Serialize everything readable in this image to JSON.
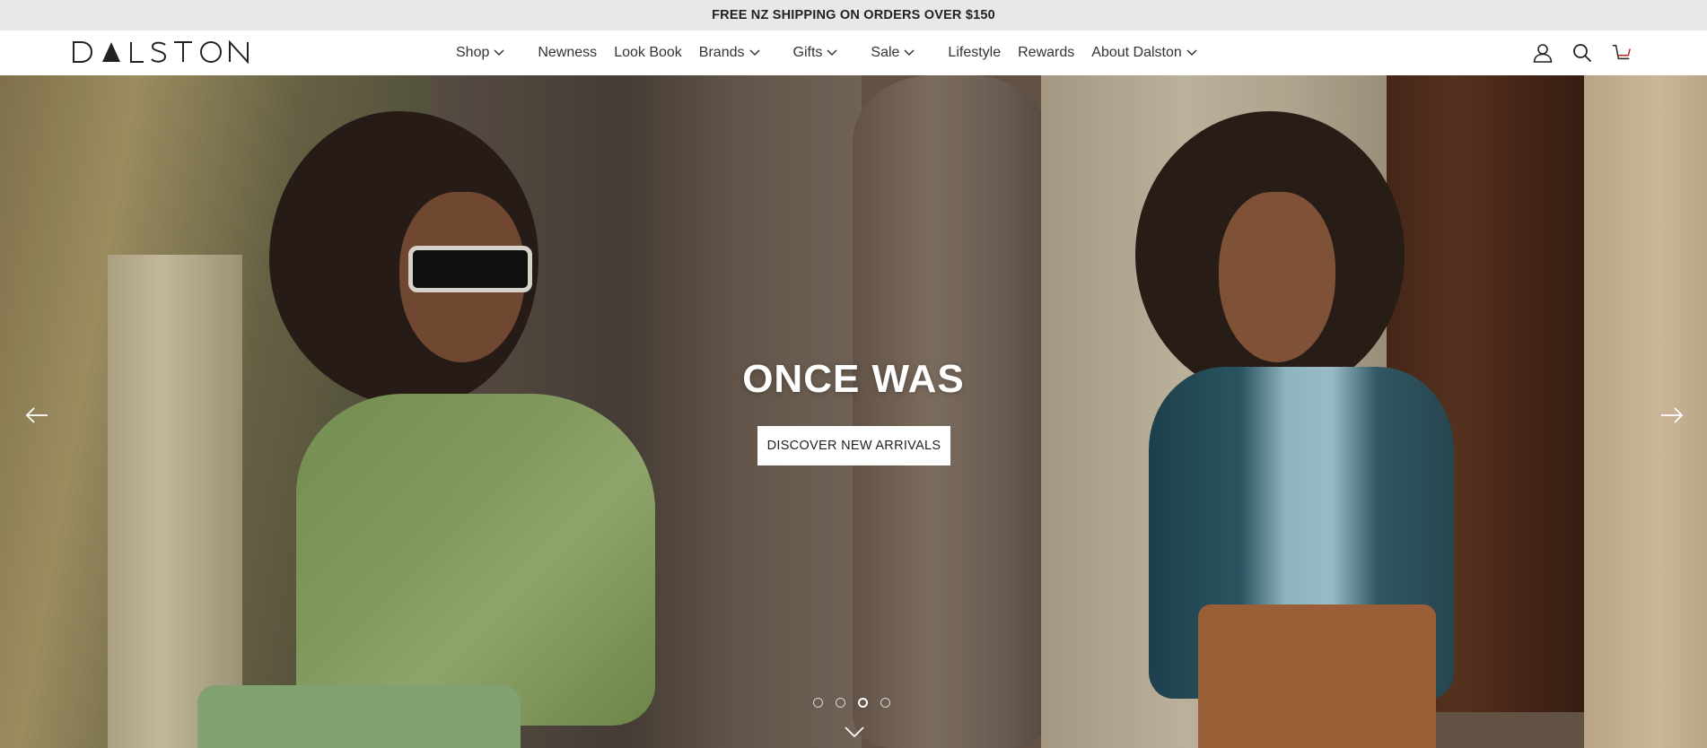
{
  "announcement": {
    "text": "FREE NZ SHIPPING ON ORDERS OVER $150"
  },
  "header": {
    "logo_text": "DALSTON",
    "nav": [
      {
        "label": "Shop",
        "has_dropdown": true
      },
      {
        "label": "Newness",
        "has_dropdown": false
      },
      {
        "label": "Look Book",
        "has_dropdown": false
      },
      {
        "label": "Brands",
        "has_dropdown": true
      },
      {
        "label": "Gifts",
        "has_dropdown": true
      },
      {
        "label": "Sale",
        "has_dropdown": true
      },
      {
        "label": "Lifestyle",
        "has_dropdown": false
      },
      {
        "label": "Rewards",
        "has_dropdown": false
      },
      {
        "label": "About Dalston",
        "has_dropdown": true
      }
    ],
    "icons": [
      "account-icon",
      "search-icon",
      "cart-icon"
    ]
  },
  "hero": {
    "title": "ONCE WAS",
    "cta_label": "DISCOVER NEW ARRIVALS",
    "slide_count": 4,
    "active_slide": 3
  },
  "colors": {
    "announcement_bg": "#e8e8e8",
    "text": "#222222",
    "cta_bg": "#ffffff"
  }
}
